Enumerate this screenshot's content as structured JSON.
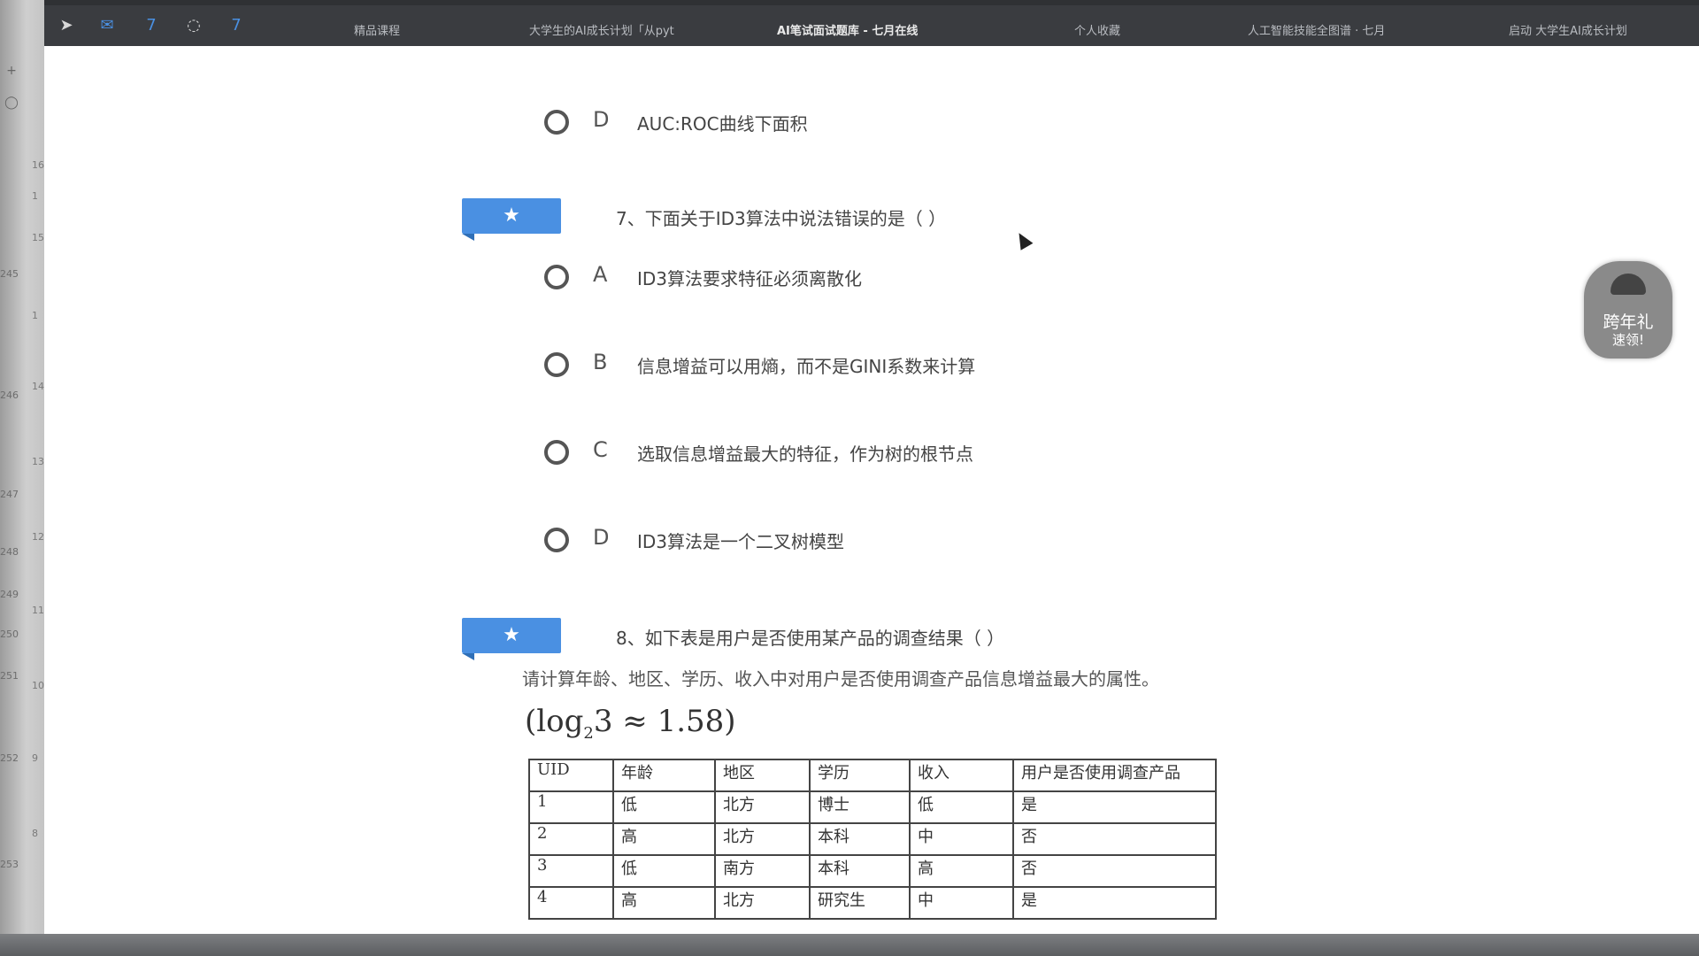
{
  "ruler": {
    "numbers": [
      "245",
      "246",
      "247",
      "248",
      "249",
      "250",
      "251",
      "252",
      "253"
    ],
    "small_numbers": [
      "16",
      "1",
      "15",
      "1",
      "14",
      "13",
      "12",
      "11",
      "10",
      "9",
      "8"
    ]
  },
  "bookmarks": {
    "items": [
      {
        "label": "精品课程",
        "active": false
      },
      {
        "label": "大学生的AI成长计划「从pyt",
        "active": false
      },
      {
        "label": "AI笔试面试题库 - 七月在线",
        "active": true
      },
      {
        "label": "个人收藏",
        "active": false
      },
      {
        "label": "人工智能技能全图谱 · 七月",
        "active": false
      },
      {
        "label": "启动 大学生AI成长计划",
        "active": false
      }
    ],
    "icons": [
      "cursor-icon",
      "mail-icon",
      "seven-icon",
      "loading-icon",
      "seven-icon-2"
    ]
  },
  "q6": {
    "option_d": {
      "letter": "D",
      "text": "AUC:ROC曲线下面积"
    }
  },
  "q7": {
    "title": "7、下面关于ID3算法中说法错误的是（ ）",
    "options": [
      {
        "letter": "A",
        "text": "ID3算法要求特征必须离散化"
      },
      {
        "letter": "B",
        "text": "信息增益可以用熵，而不是GINI系数来计算"
      },
      {
        "letter": "C",
        "text": "选取信息增益最大的特征，作为树的根节点"
      },
      {
        "letter": "D",
        "text": "ID3算法是一个二叉树模型"
      }
    ]
  },
  "q8": {
    "title": "8、如下表是用户是否使用某产品的调查结果（ ）",
    "subtitle": "请计算年龄、地区、学历、收入中对用户是否使用调查产品信息增益最大的属性。",
    "formula_prefix": "(log",
    "formula_sub": "2",
    "formula_suffix": "3 ≈ 1.58)",
    "table": {
      "headers": [
        "UID",
        "年龄",
        "地区",
        "学历",
        "收入",
        "用户是否使用调查产品"
      ],
      "rows": [
        [
          "1",
          "低",
          "北方",
          "博士",
          "低",
          "是"
        ],
        [
          "2",
          "高",
          "北方",
          "本科",
          "中",
          "否"
        ],
        [
          "3",
          "低",
          "南方",
          "本科",
          "高",
          "否"
        ],
        [
          "4",
          "高",
          "北方",
          "研究生",
          "中",
          "是"
        ]
      ]
    }
  },
  "promo": {
    "line1": "跨年礼",
    "line2": "速领!"
  },
  "colors": {
    "tag_blue": "#4a90e2",
    "topbar": "#3a3c40"
  }
}
